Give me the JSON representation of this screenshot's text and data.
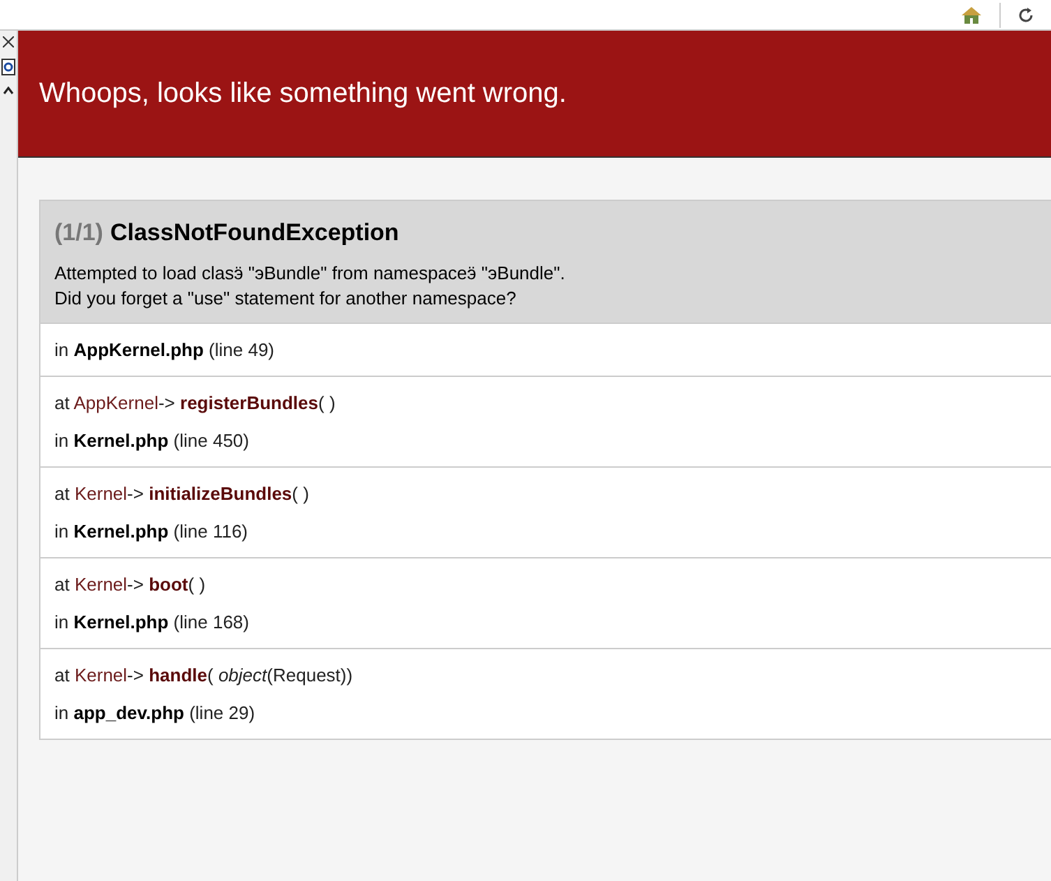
{
  "banner": {
    "title": "Whoops, looks like something went wrong."
  },
  "exception": {
    "count": "(1/1)",
    "name": "ClassNotFoundException",
    "message": [
      "Attempted to load clasӭ \"эBundle\" from namespaceӭ \"эBundle\".",
      "Did you forget a \"use\" statement for another namespace?"
    ]
  },
  "trace": [
    {
      "location": {
        "prefix": "in",
        "file": "AppKernel.php",
        "line": "(line 49)"
      }
    },
    {
      "call": {
        "prefix": "at",
        "class": "AppKernel",
        "arrow": "->",
        "method": "registerBundles",
        "args": "( )"
      },
      "location": {
        "prefix": "in",
        "file": "Kernel.php",
        "line": "(line 450)"
      }
    },
    {
      "call": {
        "prefix": "at",
        "class": "Kernel",
        "arrow": "->",
        "method": "initializeBundles",
        "args": "( )"
      },
      "location": {
        "prefix": "in",
        "file": "Kernel.php",
        "line": "(line 116)"
      }
    },
    {
      "call": {
        "prefix": "at",
        "class": "Kernel",
        "arrow": "->",
        "method": "boot",
        "args": "( )"
      },
      "location": {
        "prefix": "in",
        "file": "Kernel.php",
        "line": "(line 168)"
      }
    },
    {
      "call": {
        "prefix": "at",
        "class": "Kernel",
        "arrow": "->",
        "method": "handle",
        "args": "( *object*(Request))"
      },
      "location": {
        "prefix": "in",
        "file": "app_dev.php",
        "line": "(line 29)"
      }
    }
  ]
}
